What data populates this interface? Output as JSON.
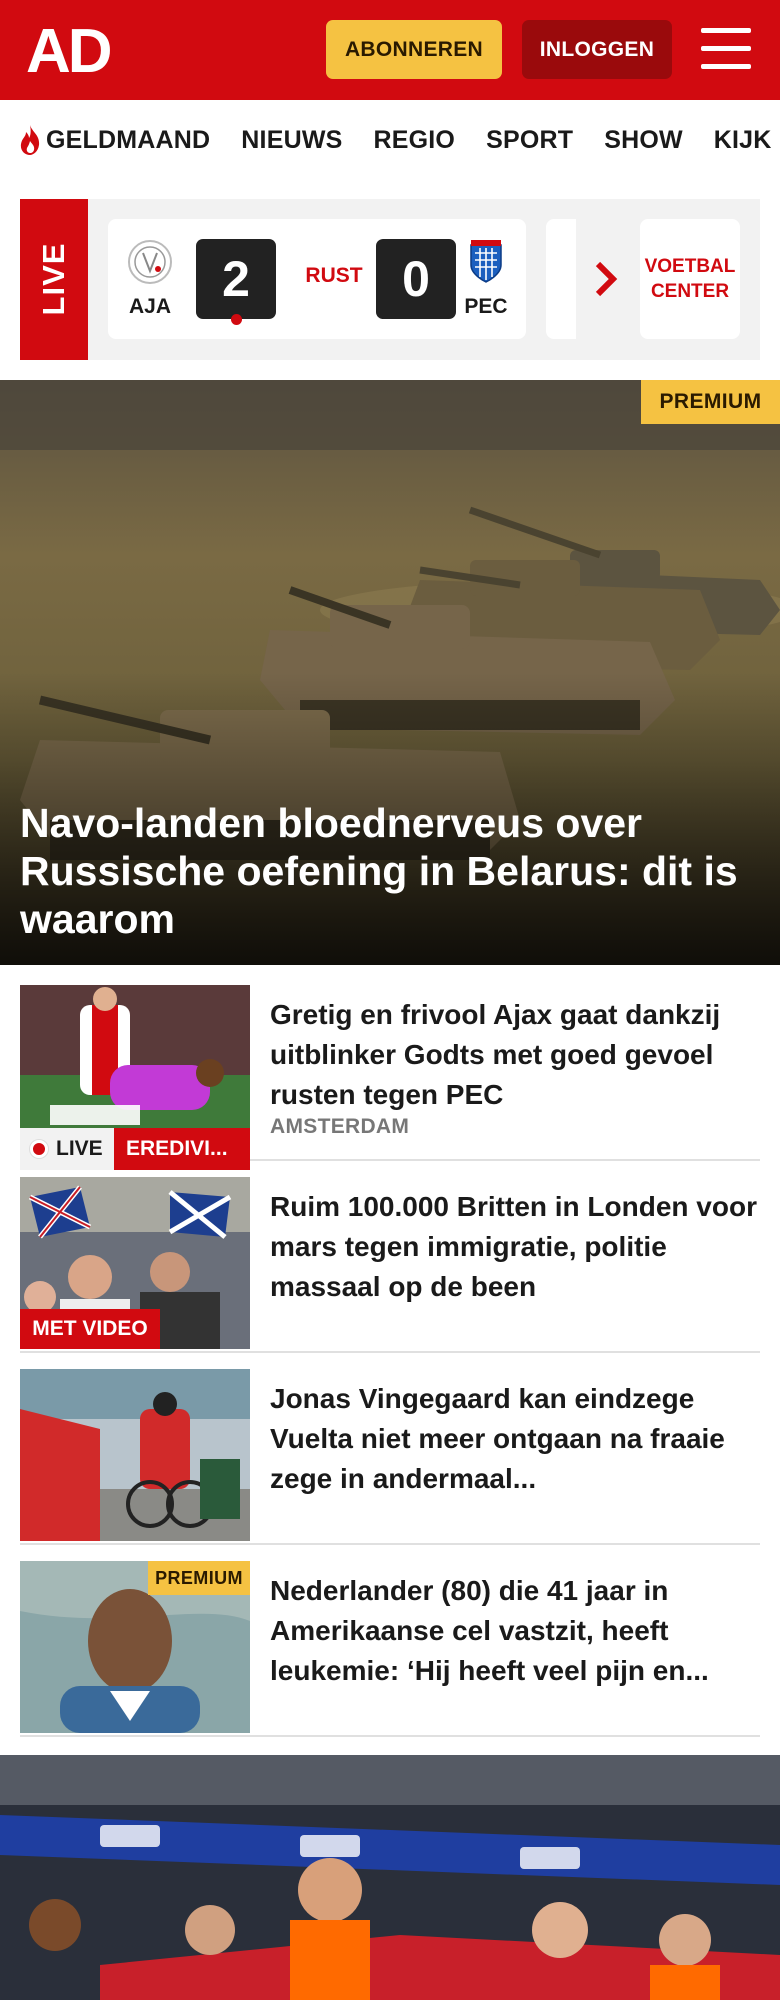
{
  "header": {
    "logo": "AD",
    "subscribe_label": "ABONNEREN",
    "login_label": "INLOGGEN",
    "colors": {
      "brand_red": "#d10a10",
      "premium_yellow": "#f5c242"
    }
  },
  "nav": {
    "items": [
      "GELDMAAND",
      "NIEUWS",
      "REGIO",
      "SPORT",
      "SHOW",
      "KIJK"
    ]
  },
  "live": {
    "label": "LIVE",
    "match": {
      "home_team": "AJA",
      "home_score": "2",
      "status": "RUST",
      "away_score": "0",
      "away_team": "PEC"
    },
    "center_label": "VOETBAL CENTER"
  },
  "hero": {
    "badge": "PREMIUM",
    "title": "Navo-landen bloednerveus over Russische oefening in Belarus: dit is waarom"
  },
  "articles": [
    {
      "title": "Gretig en frivool Ajax gaat dankzij uitblinker Godts met goed gevoel rusten tegen PEC",
      "location": "AMSTERDAM",
      "live_label": "LIVE",
      "category": "EREDIVI..."
    },
    {
      "title": "Ruim 100.000 Britten in Londen voor mars tegen immigratie, politie massaal op de been",
      "video_label": "MET VIDEO"
    },
    {
      "title": "Jonas Vingegaard kan eindzege Vuelta niet meer ontgaan na fraaie zege in andermaal..."
    },
    {
      "title": "Nederlander (80) die 41 jaar in Amerikaanse cel vastzit, heeft leukemie: ‘Hij heeft veel pijn en...",
      "badge": "PREMIUM"
    }
  ]
}
